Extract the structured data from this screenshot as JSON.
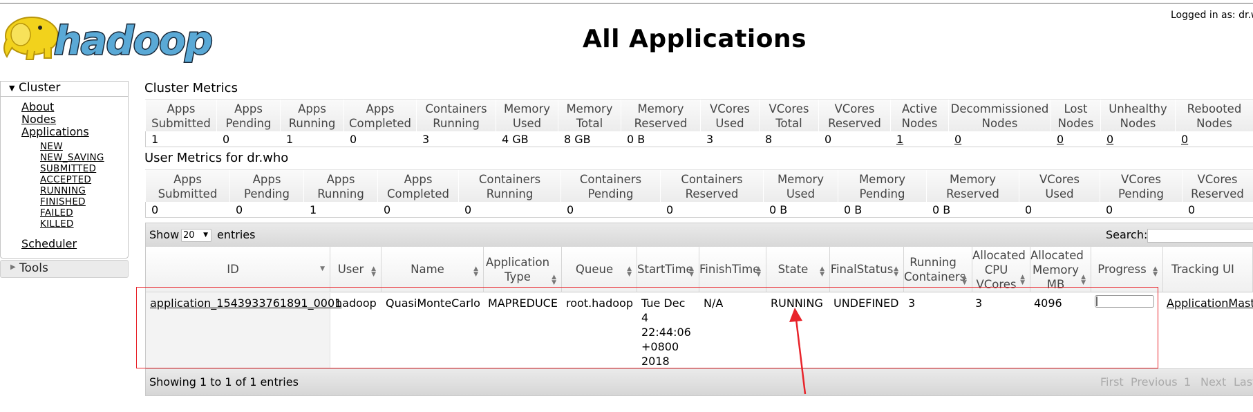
{
  "header": {
    "logo_text": "hadoop",
    "title": "All Applications",
    "logged_in": "Logged in as: dr.w"
  },
  "sidebar": {
    "cluster_label": "Cluster",
    "links": [
      "About",
      "Nodes",
      "Applications"
    ],
    "app_states": [
      "NEW",
      "NEW_SAVING",
      "SUBMITTED",
      "ACCEPTED",
      "RUNNING",
      "FINISHED",
      "FAILED",
      "KILLED"
    ],
    "scheduler": "Scheduler",
    "tools_label": "Tools"
  },
  "cluster_metrics": {
    "title": "Cluster Metrics",
    "headers": [
      [
        "Apps",
        "Submitted"
      ],
      [
        "Apps",
        "Pending"
      ],
      [
        "Apps",
        "Running"
      ],
      [
        "Apps",
        "Completed"
      ],
      [
        "Containers",
        "Running"
      ],
      [
        "Memory",
        "Used"
      ],
      [
        "Memory",
        "Total"
      ],
      [
        "Memory",
        "Reserved"
      ],
      [
        "VCores",
        "Used"
      ],
      [
        "VCores",
        "Total"
      ],
      [
        "VCores",
        "Reserved"
      ],
      [
        "Active",
        "Nodes"
      ],
      [
        "Decommissioned",
        "Nodes"
      ],
      [
        "Lost",
        "Nodes"
      ],
      [
        "Unhealthy",
        "Nodes"
      ],
      [
        "Rebooted",
        "Nodes"
      ]
    ],
    "values": [
      "1",
      "0",
      "1",
      "0",
      "3",
      "4 GB",
      "8 GB",
      "0 B",
      "3",
      "8",
      "0",
      "1",
      "0",
      "0",
      "0",
      "0"
    ]
  },
  "user_metrics": {
    "title": "User Metrics for dr.who",
    "headers": [
      [
        "Apps",
        "Submitted"
      ],
      [
        "Apps",
        "Pending"
      ],
      [
        "Apps",
        "Running"
      ],
      [
        "Apps",
        "Completed"
      ],
      [
        "Containers",
        "Running"
      ],
      [
        "Containers",
        "Pending"
      ],
      [
        "Containers",
        "Reserved"
      ],
      [
        "Memory",
        "Used"
      ],
      [
        "Memory",
        "Pending"
      ],
      [
        "Memory",
        "Reserved"
      ],
      [
        "VCores",
        "Used"
      ],
      [
        "VCores",
        "Pending"
      ],
      [
        "VCores",
        "Reserved"
      ]
    ],
    "values": [
      "0",
      "0",
      "1",
      "0",
      "0",
      "0",
      "0",
      "0 B",
      "0 B",
      "0 B",
      "0",
      "0",
      "0"
    ]
  },
  "table": {
    "show_label": "Show",
    "page_size": "20",
    "entries_label": "entries",
    "search_label": "Search:",
    "columns": [
      [
        "ID"
      ],
      [
        "User"
      ],
      [
        "Name"
      ],
      [
        "Application",
        "Type"
      ],
      [
        "Queue"
      ],
      [
        "StartTime"
      ],
      [
        "FinishTime"
      ],
      [
        "State"
      ],
      [
        "FinalStatus"
      ],
      [
        "Running",
        "Containers"
      ],
      [
        "Allocated",
        "CPU",
        "VCores"
      ],
      [
        "Allocated",
        "Memory",
        "MB"
      ],
      [
        "Progress"
      ],
      [
        "Tracking UI"
      ]
    ],
    "row": {
      "id": "application_1543933761891_0001",
      "user": "hadoop",
      "name": "QuasiMonteCarlo",
      "type": "MAPREDUCE",
      "queue": "root.hadoop",
      "start_time": [
        "Tue Dec",
        "4",
        "22:44:06",
        "+0800",
        "2018"
      ],
      "finish_time": "N/A",
      "state": "RUNNING",
      "final_status": "UNDEFINED",
      "running_containers": "3",
      "allocated_vcores": "3",
      "allocated_memory": "4096",
      "progress": 0.03,
      "tracking_ui": "ApplicationMaste"
    },
    "showing": "Showing 1 to 1 of 1 entries",
    "pager": [
      "First",
      "Previous",
      "1",
      "Next",
      "Last"
    ]
  },
  "colors": {
    "highlight": "#e8232a",
    "logo_yellow": "#f2d21c",
    "logo_blue": "#5aa9d6"
  }
}
